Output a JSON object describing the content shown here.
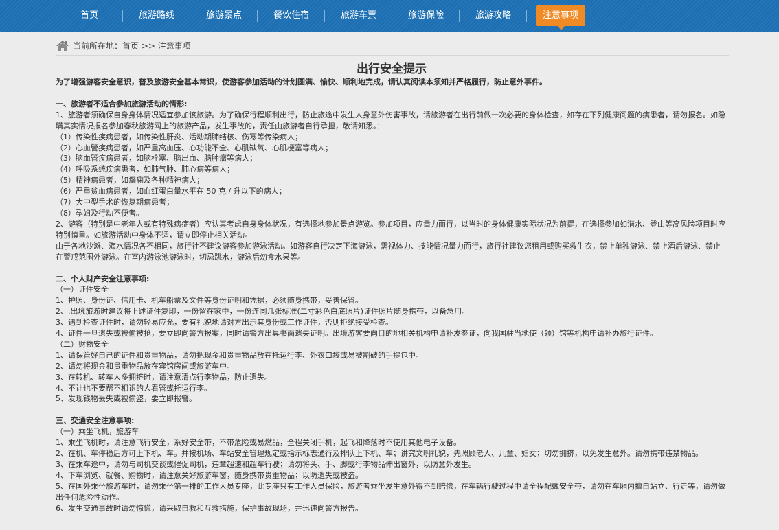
{
  "nav": {
    "items": [
      "首页",
      "旅游路线",
      "旅游景点",
      "餐饮住宿",
      "旅游车票",
      "旅游保险",
      "旅游攻略",
      "注意事项"
    ],
    "active_index": 7
  },
  "breadcrumb": {
    "label": "当前所在地：",
    "path": "首页 >> 注意事项"
  },
  "article": {
    "title": "出行安全提示",
    "lead": "为了增强游客安全意识，普及旅游安全基本常识，使游客参加活动的计划圆满、愉快、顺利地完成，请认真阅读本须知并严格履行，防止意外事件。",
    "section1": {
      "heading": "一、旅游者不适合参加旅游活动的情形:",
      "lines": [
        "1、旅游者须确保自身身体情况适宜参加该旅游。为了确保行程顺利出行，防止旅途中发生人身意外伤害事故，请旅游者在出行前做一次必要的身体检查，如存在下列健康问题的病患者，请勿报名。如隐瞒真实情况报名参加春秋旅游网上的旅游产品，发生事故的，责任由旅游者自行承担，敬请知悉。：",
        "（1）传染性疾病患者，如传染性肝炎、活动期肺结核、伤寒等传染病人；",
        "（2）心血管疾病患者，如严重高血压、心功能不全、心肌缺氧、心肌梗塞等病人；",
        "（3）脑血管疾病患者，如脑栓塞、脑出血、脑肿瘤等病人；",
        "（4）呼吸系统疾病患者，如肺气肿、肺心病等病人；",
        "（5）精神病患者，如癫痫及各种精神病人；",
        "（6）严重贫血病患者，如血红蛋白量水平在 50 克 / 升以下的病人；",
        "（7）大中型手术的恢复期病患者；",
        "（8）孕妇及行动不便者。",
        "2、游客（特别是中老年人或有特殊病症者）应认真考虑自身身体状况，有选择地参加景点游览。参加项目，应量力而行，以当时的身体健康实际状况为前提，在选择参加如潜水、登山等高风险项目时应特别慎重。如旅游活动中身体不适，请立即停止相关活动。",
        "由于各地沙滩、海水情况各不相同，旅行社不建议游客参加游泳活动。如游客自行决定下海游泳，需视体力、技能情况量力而行，旅行社建议您租用或购买救生衣，禁止单独游泳、禁止酒后游泳、禁止在警戒范围外游泳。在室内游泳池游泳时，切忌跳水，游泳后勿食水果等。"
      ]
    },
    "section2": {
      "heading": "二、个人财产安全注意事项:",
      "lines": [
        "（一）证件安全",
        "1、护照、身份证、信用卡、机车船票及文件等身份证明和凭据，必须随身携带，妥善保管。",
        "2、.出境旅游时建议将上述证件复印，一份留在家中，一份连同几张标准(二寸彩色白底照片)证件照片随身携带，以备急用。",
        "3、遇到检查证件时，请勿轻易应允，要有礼貌地请对方出示其身份或工作证件，否则拒绝接受检查。",
        "4、证件一旦遗失或被偷被抢，要立即向警方报案，同时请警方出具书面遗失证明。出境游客要向目的地相关机构申请补发签证，向我国驻当地使（领）馆等机构申请补办旅行证件。",
        "（二）财物安全",
        "1、请保管好自己的证件和贵重物品，请勿把现金和贵重物品放在托运行李、外衣口袋或易被割破的手提包中。",
        "2、请勿将现金和贵重物品放在宾馆房间或旅游车中。",
        "3、在转机、转车人多拥挤时，请注意清点行李物品，防止遗失。",
        "4、不让也不要帮不相识的人看管或托运行李。",
        "5、发现钱物丢失或被偷盗，要立即报警。"
      ]
    },
    "section3": {
      "heading": "三、交通安全注意事项:",
      "lines": [
        "（一）乘坐飞机，旅游车",
        "1、乘坐飞机时，请注意飞行安全，系好安全带，不带危险或易燃品，全程关闭手机，起飞和降落时不使用其他电子设备。",
        "2、在机、车停稳后方可上下机、车。并按机场、车站安全管理规定或指示标志通行及排队上下机、车；讲究文明礼貌，先照顾老人、儿童、妇女；切勿拥挤，以免发生意外。请勿携带违禁物品。",
        "3、在乘车途中，请勿与司机交谈或催促司机，违章超速和超车行驶；请勿将头、手、脚或行李物品伸出窗外，以防意外发生。",
        "4、下车浏览、就餐、购物时，请注意关好旅游车窗，随身携带贵重物品；以防遗失或被盗。",
        "5、在国外乘坐旅游车时，请勿乘坐第一排的工作人员专座，此专座只有工作人员保险，旅游者乘坐发生意外得不到赔偿，在车辆行驶过程中请全程配戴安全带，请勿在车厢内擅自站立、行走等，请勿做出任何危险性动作。",
        "6、发生交通事故时请勿惊慌，请采取自救和互救措施，保护事故现场，并迅速向警方报告。"
      ]
    }
  }
}
